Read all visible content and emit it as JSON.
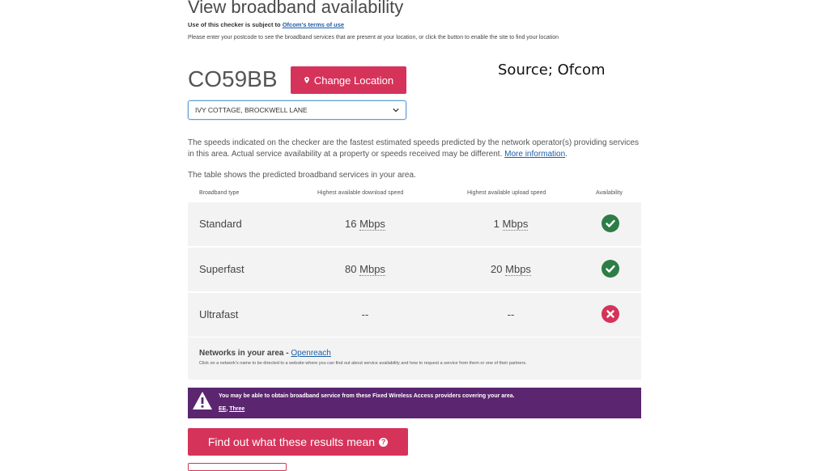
{
  "header": {
    "title": "View broadband availability",
    "terms_prefix": "Use of this checker is subject to",
    "terms_link": "Ofcom's terms of use",
    "instructions": "Please enter your postcode to see the broadband services that are present at your location, or click the button to enable the site to find your location"
  },
  "location": {
    "postcode": "CO59BB",
    "change_button": "Change Location",
    "address_selected": "IVY COTTAGE, BROCKWELL LANE"
  },
  "source_label": "Source; Ofcom",
  "info": {
    "text": "The speeds indicated on the checker are the fastest estimated speeds predicted by the network operator(s) providing services in this area. Actual service availability at a property or speeds received may be different.",
    "more_link": "More information",
    "period": ".",
    "table_intro": "The table shows the predicted broadband services in your area."
  },
  "table": {
    "headers": [
      "Broadband type",
      "Highest available download speed",
      "Highest available upload speed",
      "Availability"
    ],
    "rows": [
      {
        "type": "Standard",
        "download_value": "16",
        "download_unit": "Mbps",
        "upload_value": "1",
        "upload_unit": "Mbps",
        "available": true
      },
      {
        "type": "Superfast",
        "download_value": "80",
        "download_unit": "Mbps",
        "upload_value": "20",
        "upload_unit": "Mbps",
        "available": true
      },
      {
        "type": "Ultrafast",
        "download_value": "--",
        "download_unit": "",
        "upload_value": "--",
        "upload_unit": "",
        "available": false
      }
    ]
  },
  "networks": {
    "title": "Networks in your area - ",
    "link": "Openreach",
    "note": "Click on a network's name to be directed to a website where you can find out about service availability and how to request a service from them or one of their partners."
  },
  "fwa": {
    "text": "You may be able to obtain broadband service from these Fixed Wireless Access providers covering your area.",
    "links": [
      "EE",
      "Three"
    ],
    "separator": ", "
  },
  "results_button": "Find out what these results mean",
  "icons": {
    "location": "map-pin-icon",
    "dropdown": "chevron-down-icon",
    "available": "check-circle-icon",
    "unavailable": "x-circle-icon",
    "warning": "warning-triangle-icon",
    "help": "question-circle-icon"
  },
  "colors": {
    "brand_pink": "#d6335a",
    "available_green": "#2d7d46",
    "banner_purple": "#5b2570",
    "link_blue": "#1d5fa6"
  }
}
